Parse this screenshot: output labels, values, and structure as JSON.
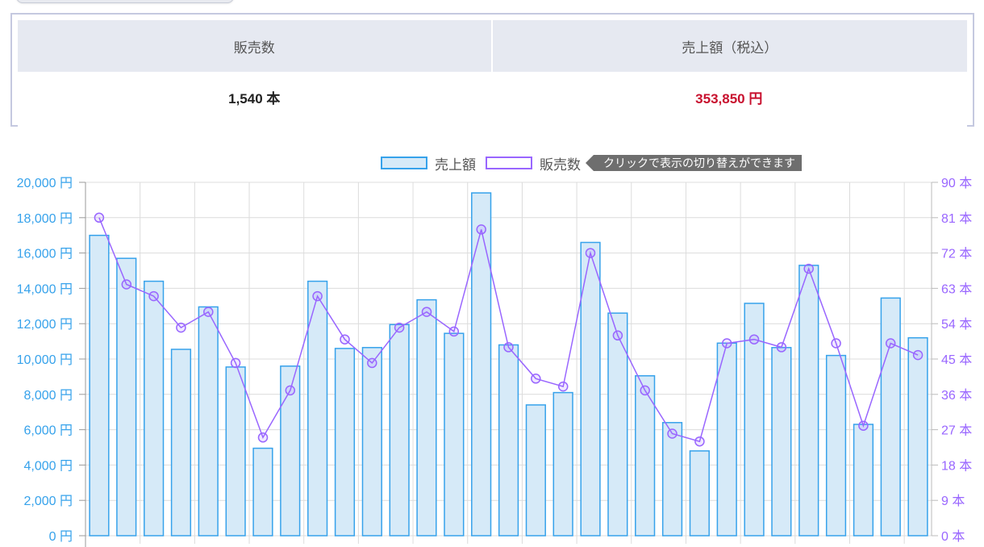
{
  "summary": {
    "headers": [
      "販売数",
      "売上額（税込）"
    ],
    "values": [
      "1,540 本",
      "353,850 円"
    ]
  },
  "legend": {
    "sales_label": "売上額",
    "count_label": "販売数",
    "hint": "クリックで表示の切り替えができます"
  },
  "colors": {
    "bar_fill": "#d6eaf8",
    "bar_stroke": "#36a2eb",
    "line": "#9966ff",
    "left_axis_text": "#36a2eb",
    "right_axis_text": "#9966ff",
    "summary_red": "#c8102e"
  },
  "chart_data": {
    "type": "bar",
    "series": [
      {
        "name": "売上額",
        "type": "bar",
        "axis": "left",
        "values": [
          17000,
          15700,
          14400,
          10550,
          12950,
          9550,
          4950,
          9600,
          14400,
          10600,
          10650,
          11950,
          13350,
          11450,
          19400,
          10800,
          7400,
          8100,
          16600,
          12600,
          9050,
          6400,
          4800,
          10900,
          13150,
          10650,
          15300,
          10200,
          6300,
          13450,
          11200
        ]
      },
      {
        "name": "販売数",
        "type": "line",
        "axis": "right",
        "values": [
          81,
          64,
          61,
          53,
          57,
          44,
          25,
          37,
          61,
          50,
          44,
          53,
          57,
          52,
          78,
          48,
          40,
          38,
          72,
          51,
          37,
          26,
          24,
          49,
          50,
          48,
          68,
          49,
          28,
          49,
          46
        ]
      }
    ],
    "left_axis": {
      "ylim": [
        0,
        20000
      ],
      "ticks": [
        "0 円",
        "2,000 円",
        "4,000 円",
        "6,000 円",
        "8,000 円",
        "10,000 円",
        "12,000 円",
        "14,000 円",
        "16,000 円",
        "18,000 円",
        "20,000 円"
      ]
    },
    "right_axis": {
      "ylim": [
        0,
        90
      ],
      "ticks": [
        "0 本",
        "9 本",
        "18 本",
        "27 本",
        "36 本",
        "45 本",
        "54 本",
        "63 本",
        "72 本",
        "81 本",
        "90 本"
      ]
    },
    "grid": true,
    "legend_position": "top-center"
  }
}
